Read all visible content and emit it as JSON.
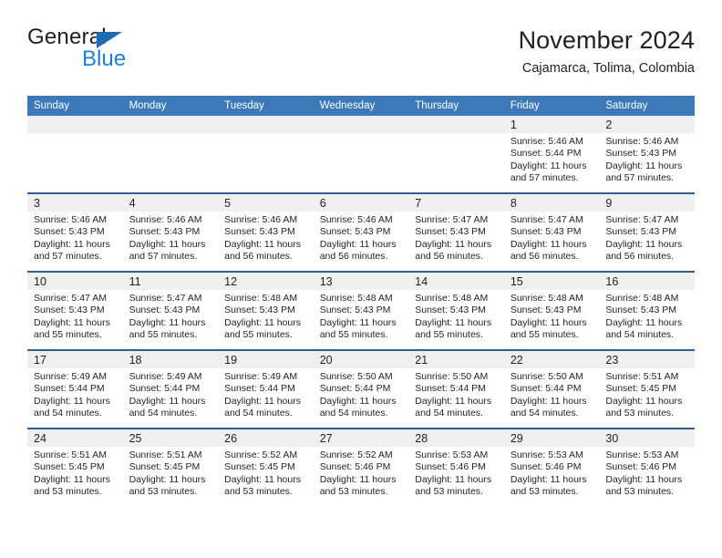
{
  "brand": {
    "name_top": "General",
    "name_bottom": "Blue"
  },
  "header": {
    "title": "November 2024",
    "subtitle": "Cajamarca, Tolima, Colombia"
  },
  "colors": {
    "header_blue": "#3b79b8",
    "row_divider": "#2e5f8f",
    "daynum_band": "#efefef",
    "brand_blue": "#1b7fd4",
    "text": "#231f20"
  },
  "weekday_headers": [
    "Sunday",
    "Monday",
    "Tuesday",
    "Wednesday",
    "Thursday",
    "Friday",
    "Saturday"
  ],
  "labels": {
    "sunrise_prefix": "Sunrise:",
    "sunset_prefix": "Sunset:",
    "daylight_prefix": "Daylight:"
  },
  "weeks": [
    [
      {
        "day": "",
        "empty": true
      },
      {
        "day": "",
        "empty": true
      },
      {
        "day": "",
        "empty": true
      },
      {
        "day": "",
        "empty": true
      },
      {
        "day": "",
        "empty": true
      },
      {
        "day": "1",
        "sunrise": "Sunrise: 5:46 AM",
        "sunset": "Sunset: 5:44 PM",
        "daylight_l1": "Daylight: 11 hours",
        "daylight_l2": "and 57 minutes."
      },
      {
        "day": "2",
        "sunrise": "Sunrise: 5:46 AM",
        "sunset": "Sunset: 5:43 PM",
        "daylight_l1": "Daylight: 11 hours",
        "daylight_l2": "and 57 minutes."
      }
    ],
    [
      {
        "day": "3",
        "sunrise": "Sunrise: 5:46 AM",
        "sunset": "Sunset: 5:43 PM",
        "daylight_l1": "Daylight: 11 hours",
        "daylight_l2": "and 57 minutes."
      },
      {
        "day": "4",
        "sunrise": "Sunrise: 5:46 AM",
        "sunset": "Sunset: 5:43 PM",
        "daylight_l1": "Daylight: 11 hours",
        "daylight_l2": "and 57 minutes."
      },
      {
        "day": "5",
        "sunrise": "Sunrise: 5:46 AM",
        "sunset": "Sunset: 5:43 PM",
        "daylight_l1": "Daylight: 11 hours",
        "daylight_l2": "and 56 minutes."
      },
      {
        "day": "6",
        "sunrise": "Sunrise: 5:46 AM",
        "sunset": "Sunset: 5:43 PM",
        "daylight_l1": "Daylight: 11 hours",
        "daylight_l2": "and 56 minutes."
      },
      {
        "day": "7",
        "sunrise": "Sunrise: 5:47 AM",
        "sunset": "Sunset: 5:43 PM",
        "daylight_l1": "Daylight: 11 hours",
        "daylight_l2": "and 56 minutes."
      },
      {
        "day": "8",
        "sunrise": "Sunrise: 5:47 AM",
        "sunset": "Sunset: 5:43 PM",
        "daylight_l1": "Daylight: 11 hours",
        "daylight_l2": "and 56 minutes."
      },
      {
        "day": "9",
        "sunrise": "Sunrise: 5:47 AM",
        "sunset": "Sunset: 5:43 PM",
        "daylight_l1": "Daylight: 11 hours",
        "daylight_l2": "and 56 minutes."
      }
    ],
    [
      {
        "day": "10",
        "sunrise": "Sunrise: 5:47 AM",
        "sunset": "Sunset: 5:43 PM",
        "daylight_l1": "Daylight: 11 hours",
        "daylight_l2": "and 55 minutes."
      },
      {
        "day": "11",
        "sunrise": "Sunrise: 5:47 AM",
        "sunset": "Sunset: 5:43 PM",
        "daylight_l1": "Daylight: 11 hours",
        "daylight_l2": "and 55 minutes."
      },
      {
        "day": "12",
        "sunrise": "Sunrise: 5:48 AM",
        "sunset": "Sunset: 5:43 PM",
        "daylight_l1": "Daylight: 11 hours",
        "daylight_l2": "and 55 minutes."
      },
      {
        "day": "13",
        "sunrise": "Sunrise: 5:48 AM",
        "sunset": "Sunset: 5:43 PM",
        "daylight_l1": "Daylight: 11 hours",
        "daylight_l2": "and 55 minutes."
      },
      {
        "day": "14",
        "sunrise": "Sunrise: 5:48 AM",
        "sunset": "Sunset: 5:43 PM",
        "daylight_l1": "Daylight: 11 hours",
        "daylight_l2": "and 55 minutes."
      },
      {
        "day": "15",
        "sunrise": "Sunrise: 5:48 AM",
        "sunset": "Sunset: 5:43 PM",
        "daylight_l1": "Daylight: 11 hours",
        "daylight_l2": "and 55 minutes."
      },
      {
        "day": "16",
        "sunrise": "Sunrise: 5:48 AM",
        "sunset": "Sunset: 5:43 PM",
        "daylight_l1": "Daylight: 11 hours",
        "daylight_l2": "and 54 minutes."
      }
    ],
    [
      {
        "day": "17",
        "sunrise": "Sunrise: 5:49 AM",
        "sunset": "Sunset: 5:44 PM",
        "daylight_l1": "Daylight: 11 hours",
        "daylight_l2": "and 54 minutes."
      },
      {
        "day": "18",
        "sunrise": "Sunrise: 5:49 AM",
        "sunset": "Sunset: 5:44 PM",
        "daylight_l1": "Daylight: 11 hours",
        "daylight_l2": "and 54 minutes."
      },
      {
        "day": "19",
        "sunrise": "Sunrise: 5:49 AM",
        "sunset": "Sunset: 5:44 PM",
        "daylight_l1": "Daylight: 11 hours",
        "daylight_l2": "and 54 minutes."
      },
      {
        "day": "20",
        "sunrise": "Sunrise: 5:50 AM",
        "sunset": "Sunset: 5:44 PM",
        "daylight_l1": "Daylight: 11 hours",
        "daylight_l2": "and 54 minutes."
      },
      {
        "day": "21",
        "sunrise": "Sunrise: 5:50 AM",
        "sunset": "Sunset: 5:44 PM",
        "daylight_l1": "Daylight: 11 hours",
        "daylight_l2": "and 54 minutes."
      },
      {
        "day": "22",
        "sunrise": "Sunrise: 5:50 AM",
        "sunset": "Sunset: 5:44 PM",
        "daylight_l1": "Daylight: 11 hours",
        "daylight_l2": "and 54 minutes."
      },
      {
        "day": "23",
        "sunrise": "Sunrise: 5:51 AM",
        "sunset": "Sunset: 5:45 PM",
        "daylight_l1": "Daylight: 11 hours",
        "daylight_l2": "and 53 minutes."
      }
    ],
    [
      {
        "day": "24",
        "sunrise": "Sunrise: 5:51 AM",
        "sunset": "Sunset: 5:45 PM",
        "daylight_l1": "Daylight: 11 hours",
        "daylight_l2": "and 53 minutes."
      },
      {
        "day": "25",
        "sunrise": "Sunrise: 5:51 AM",
        "sunset": "Sunset: 5:45 PM",
        "daylight_l1": "Daylight: 11 hours",
        "daylight_l2": "and 53 minutes."
      },
      {
        "day": "26",
        "sunrise": "Sunrise: 5:52 AM",
        "sunset": "Sunset: 5:45 PM",
        "daylight_l1": "Daylight: 11 hours",
        "daylight_l2": "and 53 minutes."
      },
      {
        "day": "27",
        "sunrise": "Sunrise: 5:52 AM",
        "sunset": "Sunset: 5:46 PM",
        "daylight_l1": "Daylight: 11 hours",
        "daylight_l2": "and 53 minutes."
      },
      {
        "day": "28",
        "sunrise": "Sunrise: 5:53 AM",
        "sunset": "Sunset: 5:46 PM",
        "daylight_l1": "Daylight: 11 hours",
        "daylight_l2": "and 53 minutes."
      },
      {
        "day": "29",
        "sunrise": "Sunrise: 5:53 AM",
        "sunset": "Sunset: 5:46 PM",
        "daylight_l1": "Daylight: 11 hours",
        "daylight_l2": "and 53 minutes."
      },
      {
        "day": "30",
        "sunrise": "Sunrise: 5:53 AM",
        "sunset": "Sunset: 5:46 PM",
        "daylight_l1": "Daylight: 11 hours",
        "daylight_l2": "and 53 minutes."
      }
    ]
  ]
}
